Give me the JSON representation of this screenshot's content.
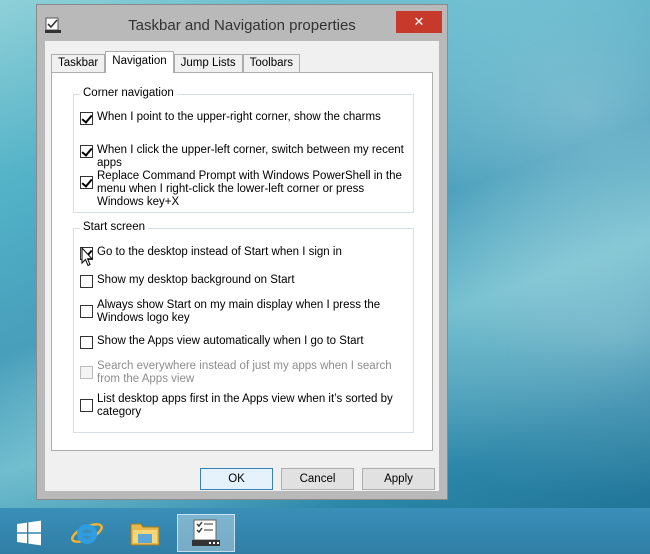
{
  "window": {
    "title": "Taskbar and Navigation properties",
    "close_symbol": "✕"
  },
  "tabs": [
    {
      "label": "Taskbar",
      "active": false
    },
    {
      "label": "Navigation",
      "active": true
    },
    {
      "label": "Jump Lists",
      "active": false
    },
    {
      "label": "Toolbars",
      "active": false
    }
  ],
  "corner_navigation": {
    "title": "Corner navigation",
    "options": [
      {
        "label": "When I point to the upper-right corner, show the charms",
        "checked": true,
        "disabled": false
      },
      {
        "label": "When I click the upper-left corner, switch between my recent apps",
        "checked": true,
        "disabled": false
      },
      {
        "label": "Replace Command Prompt with Windows PowerShell in the menu when I right-click the lower-left corner or press Windows key+X",
        "checked": true,
        "disabled": false
      }
    ]
  },
  "start_screen": {
    "title": "Start screen",
    "options": [
      {
        "label": "Go to the desktop instead of Start when I sign in",
        "checked": true,
        "disabled": false
      },
      {
        "label": "Show my desktop background on Start",
        "checked": false,
        "disabled": false
      },
      {
        "label": "Always show Start on my main display when I press the Windows logo key",
        "checked": false,
        "disabled": false
      },
      {
        "label": "Show the Apps view automatically when I go to Start",
        "checked": false,
        "disabled": false
      },
      {
        "label": "Search everywhere instead of just my apps when I search from the Apps view",
        "checked": false,
        "disabled": true
      },
      {
        "label": "List desktop apps first in the Apps view when it’s sorted by category",
        "checked": false,
        "disabled": false
      }
    ]
  },
  "buttons": {
    "ok": "OK",
    "cancel": "Cancel",
    "apply": "Apply"
  },
  "colors": {
    "close_button": "#c7392b",
    "taskbar": "#2f7ea6",
    "default_button_border": "#3c7fb1"
  },
  "taskbar_items": [
    {
      "icon": "windows-start-icon",
      "active": false
    },
    {
      "icon": "internet-explorer-icon",
      "active": false
    },
    {
      "icon": "file-explorer-icon",
      "active": false
    },
    {
      "icon": "taskbar-properties-icon",
      "active": true
    }
  ]
}
